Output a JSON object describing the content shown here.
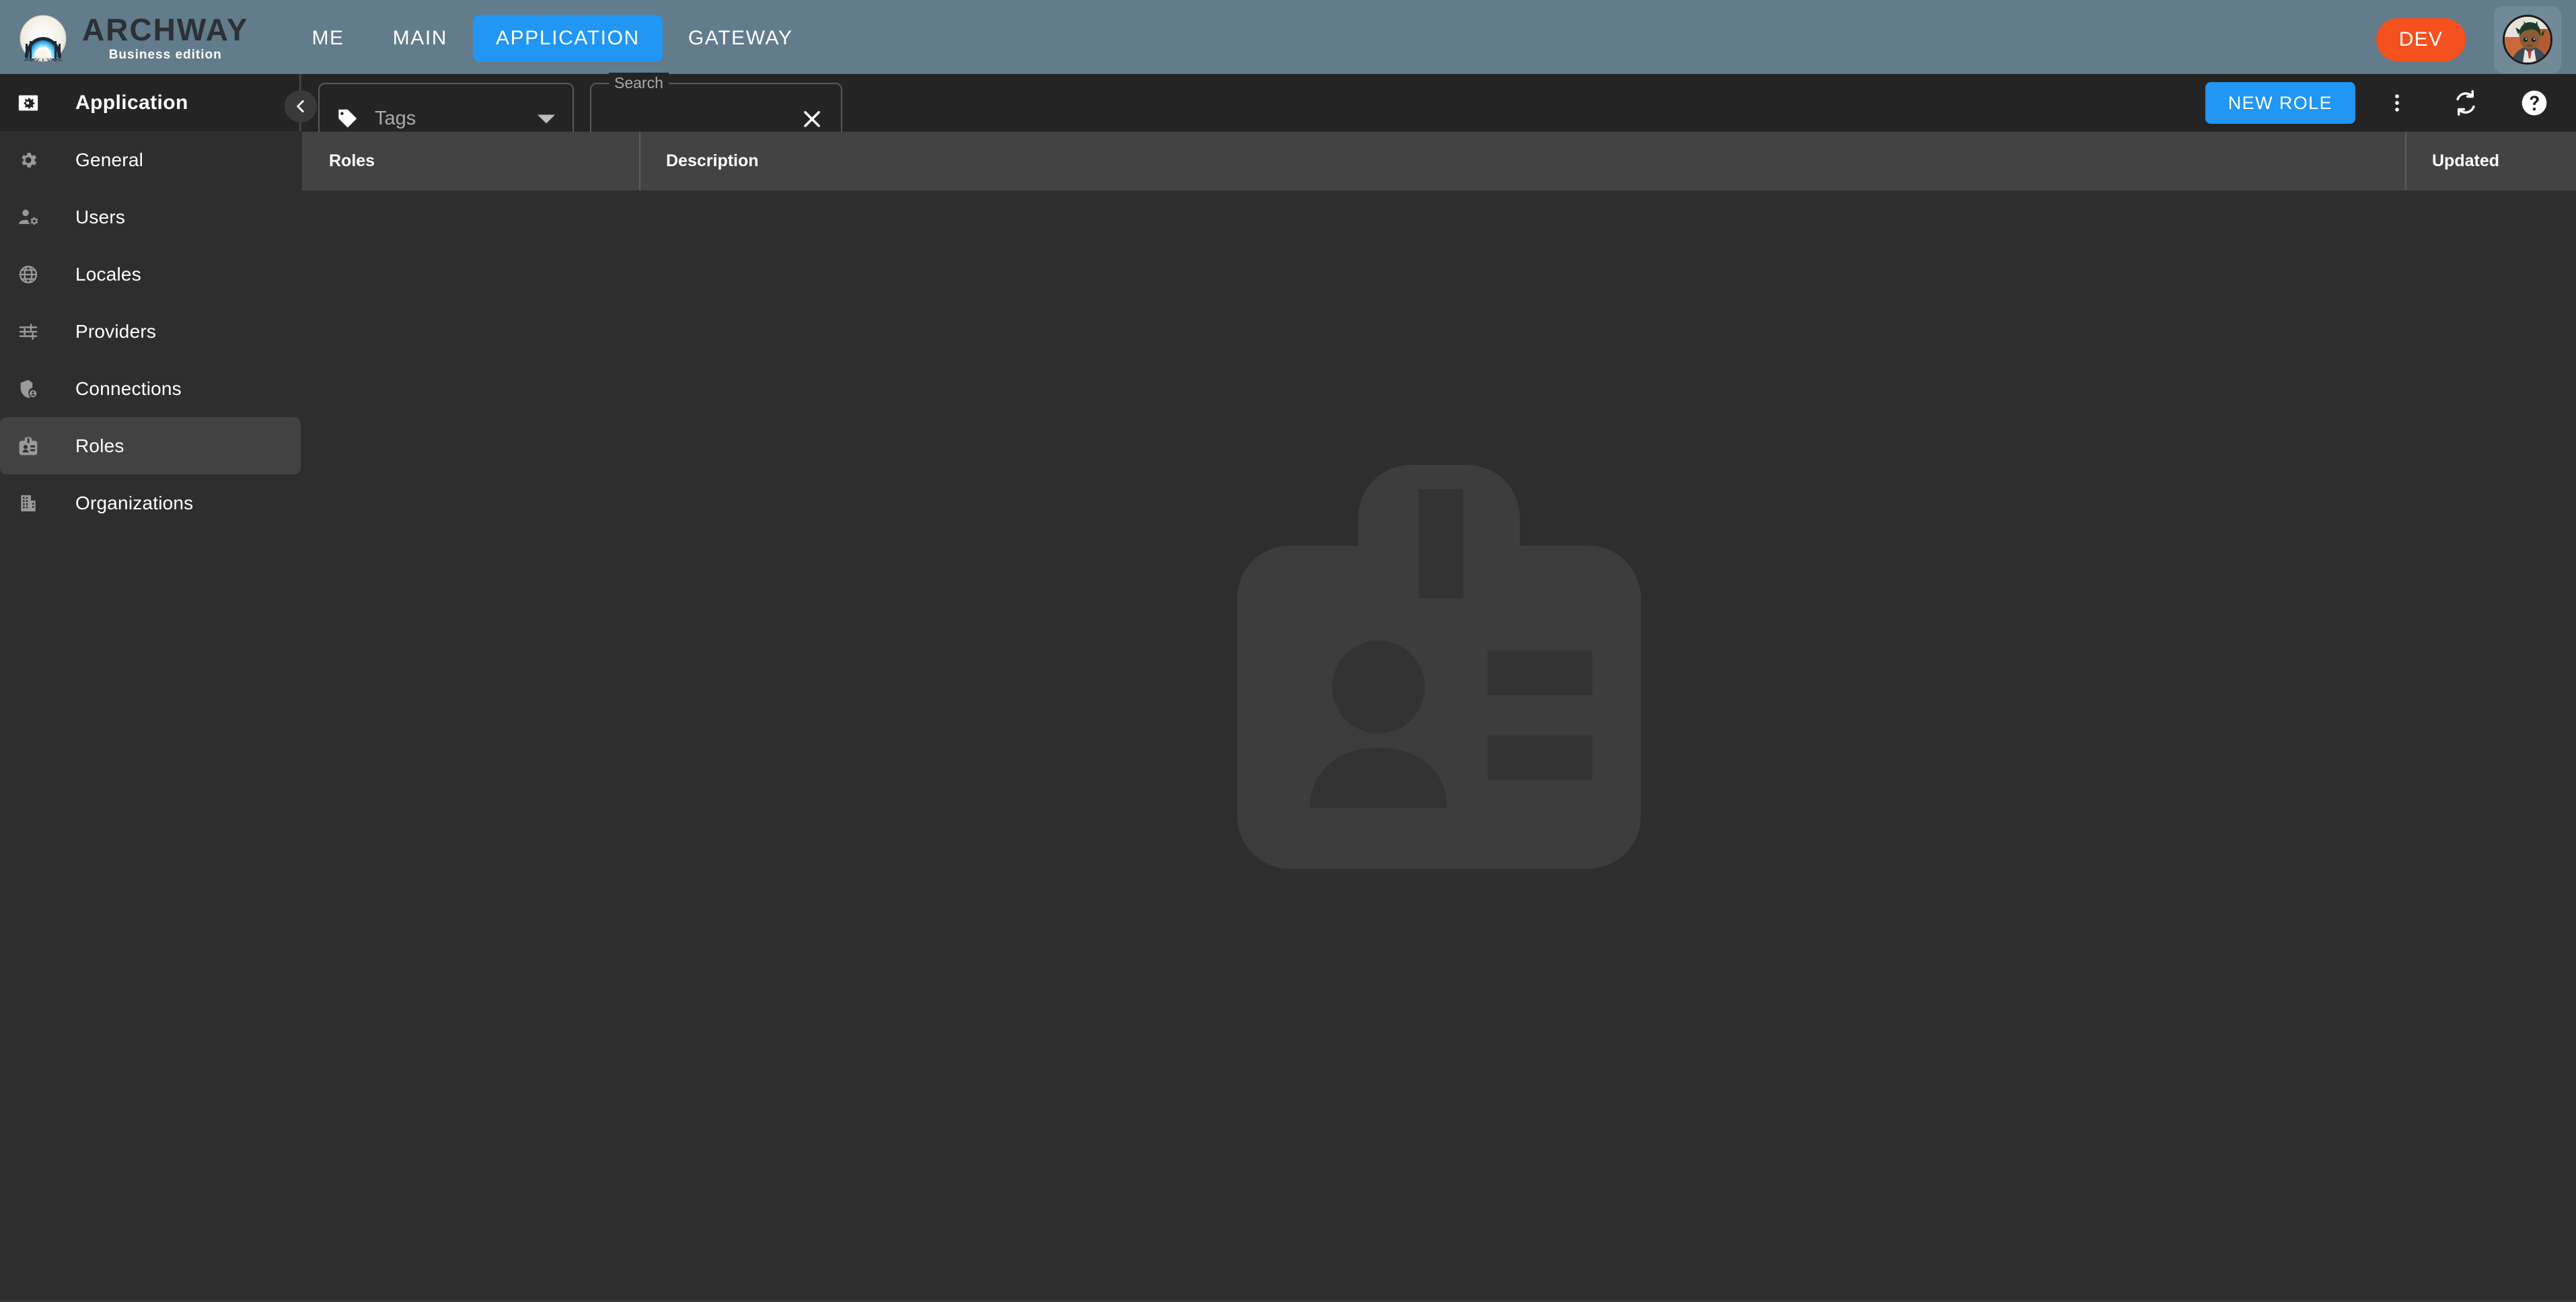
{
  "topbar": {
    "logo": {
      "name": "archway-logo",
      "title": "ARCHWAY",
      "subtitle": "Business edition"
    },
    "nav": [
      {
        "id": "me",
        "label": "ME",
        "active": false
      },
      {
        "id": "main",
        "label": "MAIN",
        "active": false
      },
      {
        "id": "application",
        "label": "APPLICATION",
        "active": true
      },
      {
        "id": "gateway",
        "label": "GATEWAY",
        "active": false
      }
    ],
    "env_badge": "DEV",
    "avatar_alt": "user-avatar",
    "colors": {
      "bar": "#627c8c",
      "accent": "#2196f3",
      "env": "#f4511e"
    }
  },
  "sidebar": {
    "header": {
      "icon": "app-settings-icon",
      "title": "Application"
    },
    "collapse_icon": "chevron-left-icon",
    "items": [
      {
        "id": "general",
        "icon": "gear-icon",
        "label": "General",
        "selected": false
      },
      {
        "id": "users",
        "icon": "user-gear-icon",
        "label": "Users",
        "selected": false
      },
      {
        "id": "locales",
        "icon": "globe-icon",
        "label": "Locales",
        "selected": false
      },
      {
        "id": "providers",
        "icon": "sliders-icon",
        "label": "Providers",
        "selected": false
      },
      {
        "id": "connections",
        "icon": "shield-user-icon",
        "label": "Connections",
        "selected": false
      },
      {
        "id": "roles",
        "icon": "badge-icon",
        "label": "Roles",
        "selected": true
      },
      {
        "id": "organizations",
        "icon": "building-icon",
        "label": "Organizations",
        "selected": false
      }
    ]
  },
  "toolbar": {
    "tags": {
      "icon": "tag-icon",
      "label": "Tags",
      "caret": "chevron-down-icon"
    },
    "search": {
      "legend": "Search",
      "value": "",
      "placeholder": "",
      "clear_icon": "close-icon"
    },
    "new_role_label": "NEW ROLE",
    "actions": [
      {
        "id": "more",
        "icon": "more-vertical-icon"
      },
      {
        "id": "refresh",
        "icon": "refresh-icon"
      },
      {
        "id": "help",
        "icon": "help-icon"
      }
    ]
  },
  "table": {
    "columns": [
      {
        "id": "roles",
        "label": "Roles"
      },
      {
        "id": "description",
        "label": "Description"
      },
      {
        "id": "updated",
        "label": "Updated"
      }
    ],
    "rows": []
  },
  "empty_state": {
    "icon": "badge-placeholder-icon"
  }
}
